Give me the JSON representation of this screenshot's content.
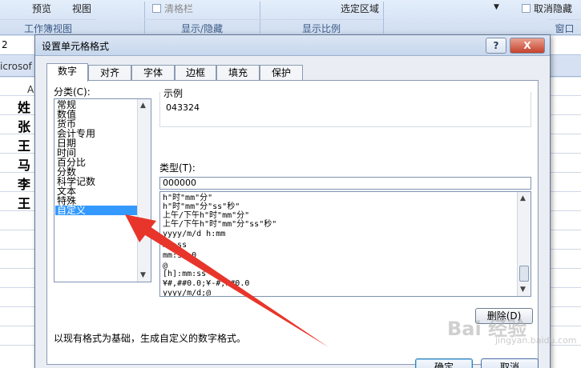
{
  "ribbon": {
    "preview": "预览",
    "view": "视图",
    "hidden_check": "清格栏",
    "select_area": "选定区域",
    "unhide_check": "取消隐藏",
    "group_workbook_views": "工作簿视图",
    "group_show_hide": "显示/隐藏",
    "group_zoom": "显示比例",
    "group_window": "窗口"
  },
  "formula_bar": {
    "cell_ref": "2"
  },
  "doc_bar": {
    "title_fragment": "icrosof"
  },
  "grid": {
    "column_header": "A",
    "cells": [
      "姓",
      "张",
      "王",
      "马",
      "李",
      "王"
    ]
  },
  "dialog": {
    "title": "设置单元格格式",
    "help": "?",
    "close": "X",
    "tabs": [
      "数字",
      "对齐",
      "字体",
      "边框",
      "填充",
      "保护"
    ],
    "category_label": "分类(C):",
    "categories": [
      "常规",
      "数值",
      "货币",
      "会计专用",
      "日期",
      "时间",
      "百分比",
      "分数",
      "科学记数",
      "文本",
      "特殊",
      "自定义"
    ],
    "selected_category": "自定义",
    "sample_label": "示例",
    "sample_value": "043324",
    "type_label": "类型(T):",
    "type_value": "000000",
    "format_codes": [
      "h\"时\"mm\"分\"",
      "h\"时\"mm\"分\"ss\"秒\"",
      "上午/下午h\"时\"mm\"分\"",
      "上午/下午h\"时\"mm\"分\"ss\"秒\"",
      "yyyy/m/d h:mm",
      "mm:ss",
      "mm:ss.0",
      "@",
      "[h]:mm:ss",
      "¥#,##0.0;¥-#,##0.0",
      "yyyy/m/d;@"
    ],
    "delete_button": "删除(D)",
    "description": "以现有格式为基础，生成自定义的数字格式。",
    "ok_button": "确定",
    "cancel_button": "取消"
  },
  "watermark": {
    "main": "Bai 经验",
    "sub": "jingyan.baidu.com"
  },
  "colors": {
    "selection": "#3399ff",
    "arrow": "#e8352b"
  }
}
